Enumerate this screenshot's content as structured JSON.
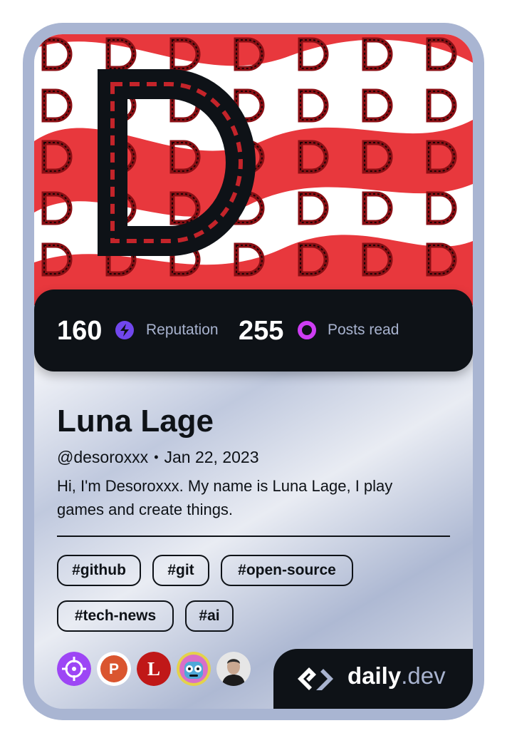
{
  "profile": {
    "name": "Luna Lage",
    "handle": "@desoroxxx",
    "separator": "•",
    "joined": "Jan 22, 2023",
    "bio": "Hi, I'm Desoroxxx. My name is Luna Lage, I play games and create things."
  },
  "stats": {
    "reputation_value": "160",
    "reputation_label": "Reputation",
    "reputation_icon": "lightning-icon",
    "posts_value": "255",
    "posts_label": "Posts read",
    "posts_icon": "eye-ring-icon"
  },
  "tags": [
    "#github",
    "#git",
    "#open-source",
    "#tech-news",
    "#ai"
  ],
  "squads": [
    {
      "icon": "crosshair-squad-icon",
      "color": "#9d46f5"
    },
    {
      "icon": "product-hunt-icon",
      "letter": "P",
      "color": "#da552f"
    },
    {
      "icon": "l-squad-icon",
      "letter": "L",
      "color": "#c01818"
    },
    {
      "icon": "robot-avatar-icon",
      "color": "#4fa8d8"
    },
    {
      "icon": "person-avatar-icon",
      "color": "#d8d8d8"
    }
  ],
  "brand": {
    "name": "daily",
    "tld": ".dev"
  },
  "colors": {
    "cover_red": "#e8383d",
    "dark": "#0e1217",
    "reputation_accent": "#7147ed",
    "posts_accent": "#ce3df3",
    "frame": "#a9b5d2"
  }
}
